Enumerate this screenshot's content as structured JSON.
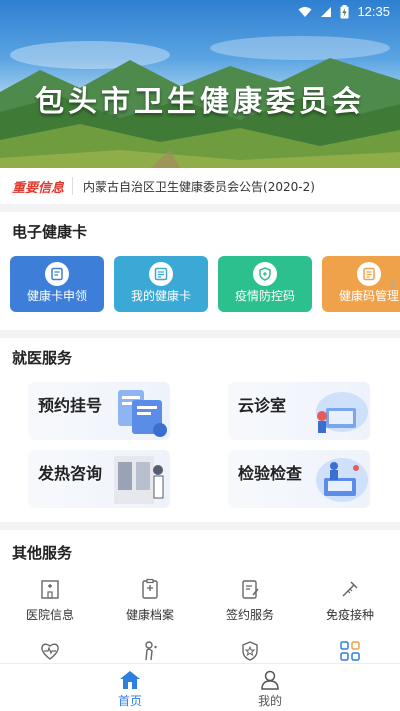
{
  "status_bar": {
    "time": "12:35"
  },
  "hero": {
    "title": "包头市卫生健康委员会"
  },
  "notice": {
    "tag": "重要信息",
    "text": "内蒙古自治区卫生健康委员会公告(2020-2)"
  },
  "health_card": {
    "title": "电子健康卡",
    "items": [
      {
        "label": "健康卡申领",
        "icon": "card-apply-icon",
        "color": "#3d7fd8"
      },
      {
        "label": "我的健康卡",
        "icon": "my-card-icon",
        "color": "#3aa9d6"
      },
      {
        "label": "疫情防控码",
        "icon": "shield-code-icon",
        "color": "#2cc08e"
      },
      {
        "label": "健康码管理",
        "icon": "code-manage-icon",
        "color": "#f0a24b"
      }
    ]
  },
  "medical": {
    "title": "就医服务",
    "items": [
      {
        "label": "预约挂号"
      },
      {
        "label": "云诊室"
      },
      {
        "label": "发热咨询"
      },
      {
        "label": "检验检查"
      }
    ]
  },
  "other": {
    "title": "其他服务",
    "items": [
      {
        "label": "医院信息",
        "icon": "hospital-icon"
      },
      {
        "label": "健康档案",
        "icon": "health-record-icon"
      },
      {
        "label": "签约服务",
        "icon": "sign-service-icon"
      },
      {
        "label": "免疫接种",
        "icon": "vaccine-icon"
      }
    ],
    "row2_icons": [
      "heart-monitor-icon",
      "maternal-icon",
      "award-icon",
      "grid-apps-icon"
    ]
  },
  "bottom_nav": {
    "items": [
      {
        "label": "首页",
        "icon": "home-icon",
        "active": true
      },
      {
        "label": "我的",
        "icon": "user-icon",
        "active": false
      }
    ],
    "active_color": "#2f7fe0",
    "inactive_color": "#555555"
  }
}
